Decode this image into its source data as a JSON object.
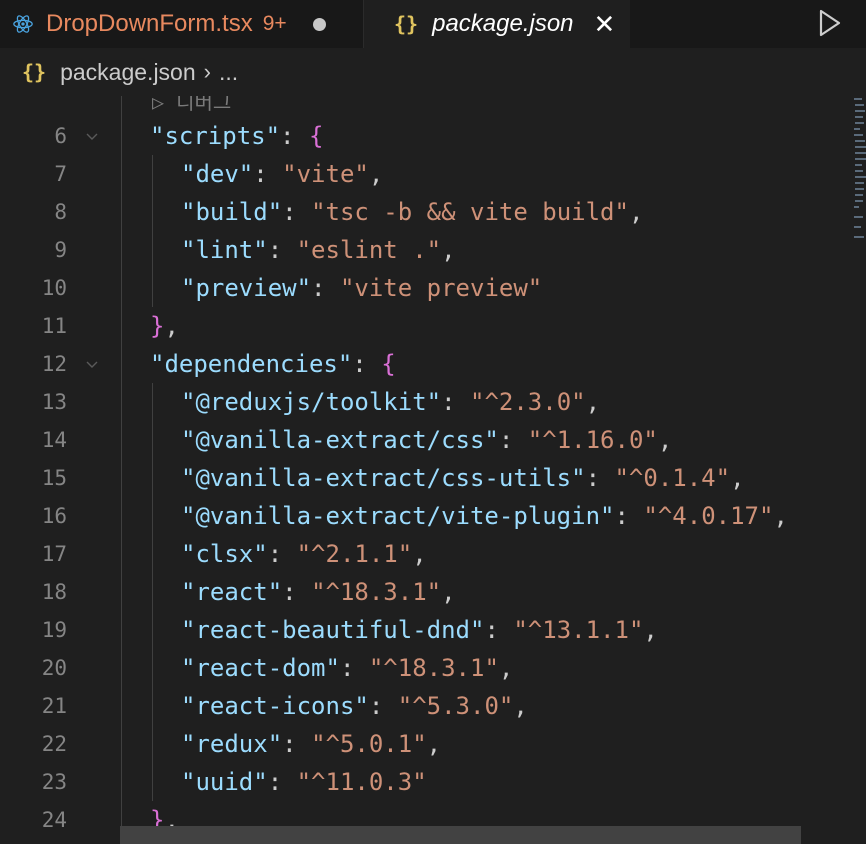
{
  "tabs": [
    {
      "name": "DropDownForm.tsx",
      "badge": "9+",
      "active": false,
      "dirty": true
    },
    {
      "name": "package.json",
      "active": true
    }
  ],
  "breadcrumb": {
    "file": "package.json",
    "more": "..."
  },
  "codelens": "▷ 디버그",
  "lines": [
    {
      "num": "6",
      "key": "\"scripts\"",
      "sep": ": ",
      "brace": "{"
    },
    {
      "num": "7",
      "key": "\"dev\"",
      "sep": ": ",
      "value": "\"vite\"",
      "tail": ","
    },
    {
      "num": "8",
      "key": "\"build\"",
      "sep": ": ",
      "value": "\"tsc -b && vite build\"",
      "tail": ","
    },
    {
      "num": "9",
      "key": "\"lint\"",
      "sep": ": ",
      "value": "\"eslint .\"",
      "tail": ","
    },
    {
      "num": "10",
      "key": "\"preview\"",
      "sep": ": ",
      "value": "\"vite preview\"",
      "tail": ""
    },
    {
      "num": "11",
      "close": "}",
      "tail": ","
    },
    {
      "num": "12",
      "key": "\"dependencies\"",
      "sep": ": ",
      "brace": "{"
    },
    {
      "num": "13",
      "key": "\"@reduxjs/toolkit\"",
      "sep": ": ",
      "value": "\"^2.3.0\"",
      "tail": ","
    },
    {
      "num": "14",
      "key": "\"@vanilla-extract/css\"",
      "sep": ": ",
      "value": "\"^1.16.0\"",
      "tail": ","
    },
    {
      "num": "15",
      "key": "\"@vanilla-extract/css-utils\"",
      "sep": ": ",
      "value": "\"^0.1.4\"",
      "tail": ","
    },
    {
      "num": "16",
      "key": "\"@vanilla-extract/vite-plugin\"",
      "sep": ": ",
      "value": "\"^4.0.17\"",
      "tail": ","
    },
    {
      "num": "17",
      "key": "\"clsx\"",
      "sep": ": ",
      "value": "\"^2.1.1\"",
      "tail": ","
    },
    {
      "num": "18",
      "key": "\"react\"",
      "sep": ": ",
      "value": "\"^18.3.1\"",
      "tail": ","
    },
    {
      "num": "19",
      "key": "\"react-beautiful-dnd\"",
      "sep": ": ",
      "value": "\"^13.1.1\"",
      "tail": ","
    },
    {
      "num": "20",
      "key": "\"react-dom\"",
      "sep": ": ",
      "value": "\"^18.3.1\"",
      "tail": ","
    },
    {
      "num": "21",
      "key": "\"react-icons\"",
      "sep": ": ",
      "value": "\"^5.3.0\"",
      "tail": ","
    },
    {
      "num": "22",
      "key": "\"redux\"",
      "sep": ": ",
      "value": "\"^5.0.1\"",
      "tail": ","
    },
    {
      "num": "23",
      "key": "\"uuid\"",
      "sep": ": ",
      "value": "\"^11.0.3\"",
      "tail": ""
    },
    {
      "num": "24",
      "close": "}",
      "tail": ","
    }
  ],
  "colors": {
    "key": "#9cdcfe",
    "string": "#ce9178",
    "bracket": "#da70d6",
    "modified_tab": "#e8895f"
  }
}
